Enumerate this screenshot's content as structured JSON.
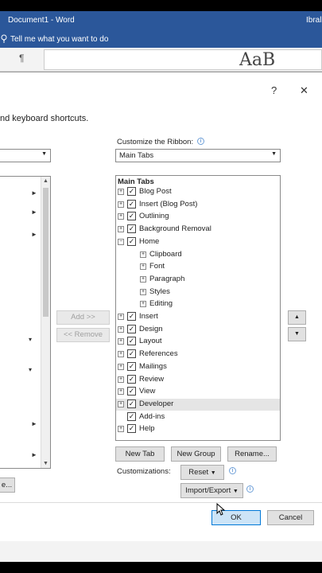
{
  "app": {
    "title": "Document1 - Word",
    "user": "Ibral",
    "tell_me": "Tell me what you want to do",
    "pilcrow": "¶",
    "styles_preview": "AaB"
  },
  "dialog": {
    "help": "?",
    "close": "✕",
    "description": "nd keyboard shortcuts.",
    "left_combo_value": "",
    "customize_label": "Customize the Ribbon:",
    "ribbon_combo_value": "Main Tabs",
    "add_label": "Add >>",
    "remove_label": "<< Remove",
    "left_partial_button": "e...",
    "new_tab": "New Tab",
    "new_group": "New Group",
    "rename": "Rename...",
    "customizations_label": "Customizations:",
    "reset": "Reset",
    "import_export": "Import/Export",
    "ok": "OK",
    "cancel": "Cancel",
    "move_up_icon": "triangle-up-icon",
    "move_down_icon": "triangle-down-icon"
  },
  "tree": {
    "header": "Main Tabs",
    "items": [
      {
        "label": "Blog Post",
        "level": 0,
        "expander": "+",
        "checked": true
      },
      {
        "label": "Insert (Blog Post)",
        "level": 0,
        "expander": "+",
        "checked": true
      },
      {
        "label": "Outlining",
        "level": 0,
        "expander": "+",
        "checked": true
      },
      {
        "label": "Background Removal",
        "level": 0,
        "expander": "+",
        "checked": true
      },
      {
        "label": "Home",
        "level": 0,
        "expander": "−",
        "checked": true
      },
      {
        "label": "Clipboard",
        "level": 1,
        "expander": "+",
        "checked": null
      },
      {
        "label": "Font",
        "level": 1,
        "expander": "+",
        "checked": null
      },
      {
        "label": "Paragraph",
        "level": 1,
        "expander": "+",
        "checked": null
      },
      {
        "label": "Styles",
        "level": 1,
        "expander": "+",
        "checked": null
      },
      {
        "label": "Editing",
        "level": 1,
        "expander": "+",
        "checked": null
      },
      {
        "label": "Insert",
        "level": 0,
        "expander": "+",
        "checked": true
      },
      {
        "label": "Design",
        "level": 0,
        "expander": "+",
        "checked": true
      },
      {
        "label": "Layout",
        "level": 0,
        "expander": "+",
        "checked": true
      },
      {
        "label": "References",
        "level": 0,
        "expander": "+",
        "checked": true
      },
      {
        "label": "Mailings",
        "level": 0,
        "expander": "+",
        "checked": true
      },
      {
        "label": "Review",
        "level": 0,
        "expander": "+",
        "checked": true
      },
      {
        "label": "View",
        "level": 0,
        "expander": "+",
        "checked": true
      },
      {
        "label": "Developer",
        "level": 0,
        "expander": "+",
        "checked": true,
        "selected": true
      },
      {
        "label": "Add-ins",
        "level": 0,
        "expander": "",
        "checked": true
      },
      {
        "label": "Help",
        "level": 0,
        "expander": "+",
        "checked": true
      }
    ]
  },
  "colors": {
    "title_bar": "#2b579a",
    "ok_border": "#0078d7"
  }
}
